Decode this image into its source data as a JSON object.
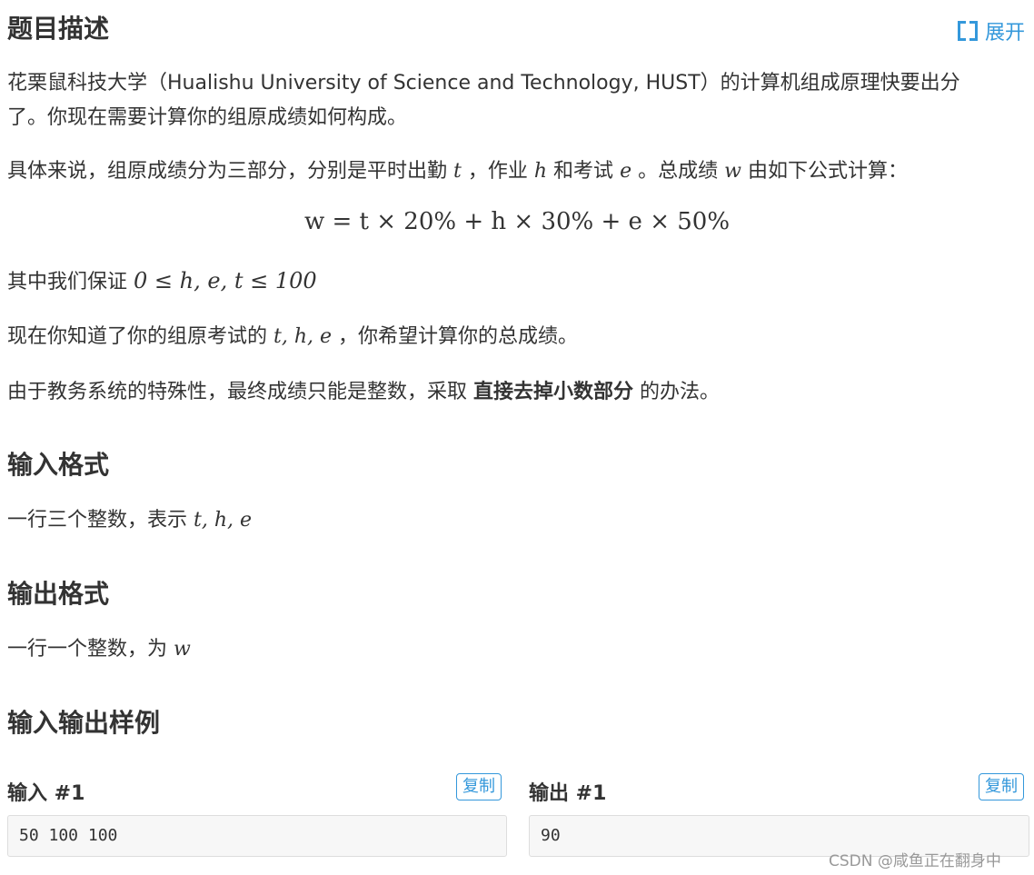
{
  "header": {
    "title": "题目描述",
    "expand_label": "展开"
  },
  "description": {
    "para1_line1": "花栗鼠科技大学（Hualishu University of Science and Technology, HUST）的计算机组成原理快要出分",
    "para1_line2": "了。你现在需要计算你的组原成绩如何构成。",
    "para2_prefix": "具体来说，组原成绩分为三部分，分别是平时出勤",
    "para2_t": "t",
    "para2_sep1": "，作业",
    "para2_h": "h",
    "para2_and": "和考试",
    "para2_e": "e",
    "para2_total": "。总成绩",
    "para2_w": "w",
    "para2_suffix": "由如下公式计算：",
    "formula": "w = t × 20% + h × 30% + e × 50%",
    "para3_prefix": "其中我们保证",
    "para3_math": "0 ≤ h, e, t ≤ 100",
    "para4_prefix": "现在你知道了你的组原考试的",
    "para4_math": "t, h, e",
    "para4_suffix": "，你希望计算你的总成绩。",
    "para5_prefix": "由于教务系统的特殊性，最终成绩只能是整数，采取",
    "para5_bold": "直接去掉小数部分",
    "para5_suffix": "的办法。"
  },
  "input_format": {
    "title": "输入格式",
    "text": "一行三个整数，表示",
    "math": "t, h, e"
  },
  "output_format": {
    "title": "输出格式",
    "text": "一行一个整数，为",
    "math": "w"
  },
  "samples": {
    "title": "输入输出样例",
    "input_title": "输入 #1",
    "output_title": "输出 #1",
    "copy_label": "复制",
    "input_value": "50 100 100",
    "output_value": "90"
  },
  "watermark": "CSDN @咸鱼正在翻身中",
  "colors": {
    "accent": "#3498db",
    "text": "#333333",
    "sample_bg": "#f7f7f7"
  },
  "icons": {
    "expand": "expand-icon"
  }
}
